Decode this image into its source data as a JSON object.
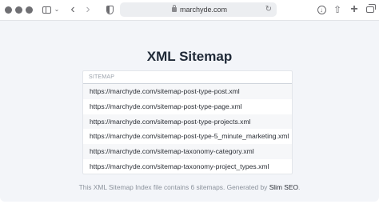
{
  "browser": {
    "url": "marchyde.com"
  },
  "page": {
    "title": "XML Sitemap",
    "table_header": "SITEMAP",
    "sitemaps": [
      "https://marchyde.com/sitemap-post-type-post.xml",
      "https://marchyde.com/sitemap-post-type-page.xml",
      "https://marchyde.com/sitemap-post-type-projects.xml",
      "https://marchyde.com/sitemap-post-type-5_minute_marketing.xml",
      "https://marchyde.com/sitemap-taxonomy-category.xml",
      "https://marchyde.com/sitemap-taxonomy-project_types.xml"
    ],
    "footer_text": "This XML Sitemap Index file contains 6 sitemaps. Generated by ",
    "footer_link": "Slim SEO",
    "footer_end": "."
  }
}
